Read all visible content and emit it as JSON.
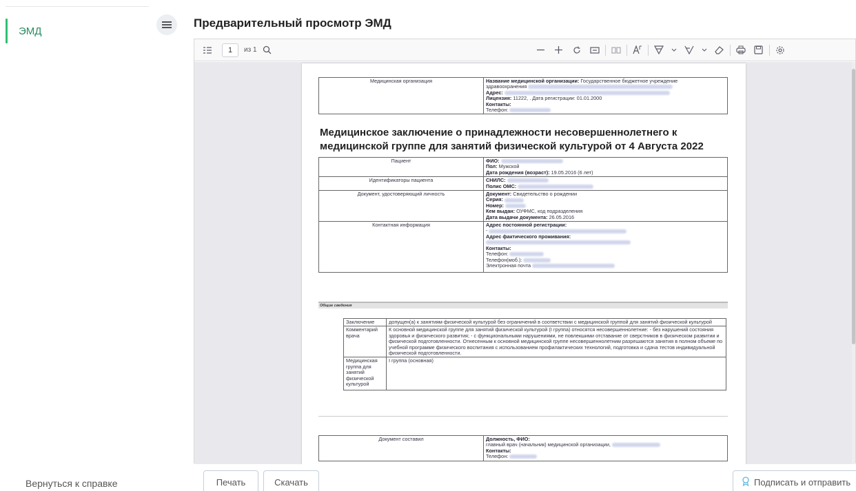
{
  "sidebar": {
    "items": [
      {
        "label": "ЭМД",
        "active": true
      }
    ],
    "back_link": "Вернуться к справке"
  },
  "header": {
    "title": "Предварительный просмотр ЭМД"
  },
  "viewer_toolbar": {
    "page_number": "1",
    "page_of": "из 1",
    "icons": [
      "sidebar-toggle-icon",
      "search-icon",
      "zoom-out-icon",
      "zoom-in-icon",
      "rotate-icon",
      "fit-page-icon",
      "two-page-icon",
      "text-icon",
      "highlight-icon",
      "draw-icon",
      "eraser-icon",
      "print-icon",
      "save-icon",
      "settings-icon"
    ]
  },
  "document": {
    "org_table": {
      "label": "Медицинская организация",
      "name_label": "Название медицинской организации:",
      "name_value": "Государственное бюджетное учреждение",
      "name_value_cont": "здравоохранения",
      "address_label": "Адрес:",
      "license_label": "Лицензия:",
      "license_value": "11222, . Дата регистрации: 01.01.2000",
      "contacts_label": "Контакты:",
      "phone_label": "Телефон:"
    },
    "heading": "Медицинское заключение о принадлежности несовершеннолетнего к медицинской группе для занятий физической культурой от 4 Августа 2022",
    "patient_table": {
      "patient_label": "Пациент",
      "fio_label": "ФИО:",
      "sex_label": "Пол:",
      "sex_value": "Мужской",
      "dob_label": "Дата рождения (возраст):",
      "dob_value": "19.05.2016 (6 лет)",
      "ids_label": "Идентификаторы пациента",
      "snils_label": "СНИЛС:",
      "oms_label": "Полис ОМС:",
      "doc_label": "Документ, удостоверяющий личность",
      "document_label": "Документ:",
      "document_value": "Свидетельство о рождении",
      "series_label": "Серия:",
      "number_label": "Номер:",
      "issued_label": "Кем выдан:",
      "issued_value": "ОУФМС, код подразделения",
      "issue_date_label": "Дата выдачи документа:",
      "issue_date_value": "26.05.2016",
      "contact_info_label": "Контактная информация",
      "reg_addr_label": "Адрес постоянной регистрации:",
      "dash": "-",
      "fact_addr_label": "Адрес фактического проживания:",
      "contacts_label": "Контакты:",
      "phone_label": "Телефон:",
      "mobile_label": "Телефон(моб.):",
      "email_label": "Электронная почта"
    },
    "general_section": "Общие сведения",
    "general_table": {
      "conclusion_label": "Заключение",
      "conclusion_value": "допущен(а) к занятиям физической культурой без ограничений в соответствии с медицинской группой для занятий физической культурой",
      "comment_label": "Комментарий врача",
      "comment_value": "К основной медицинской группе для занятий физической культурой (I группа) относятся несовершеннолетние: - без нарушений состояния здоровья и физического развития; - с функциональными нарушениями, не повлекшими отставание от сверстников в физическом развитии и физической подготовленности. Отнесенным к основной медицинской группе несовершеннолетним разрешаются занятия в полном объеме по учебной программе физического воспитания с использованием профилактических технологий, подготовка и сдача тестов индивидуальной физической подготовленности.",
      "group_label": "Медицинская группа для занятий физической культурой",
      "group_value": "I группа (основная)"
    },
    "author_table": {
      "label": "Документ составил",
      "position_label": "Должность, ФИО:",
      "position_value": "главный врач (начальник) медицинской организации,",
      "contacts_label": "Контакты:",
      "phone_label": "Телефон:"
    }
  },
  "buttons": {
    "print": "Печать",
    "download": "Скачать",
    "sign_send": "Подписать и отправить"
  }
}
